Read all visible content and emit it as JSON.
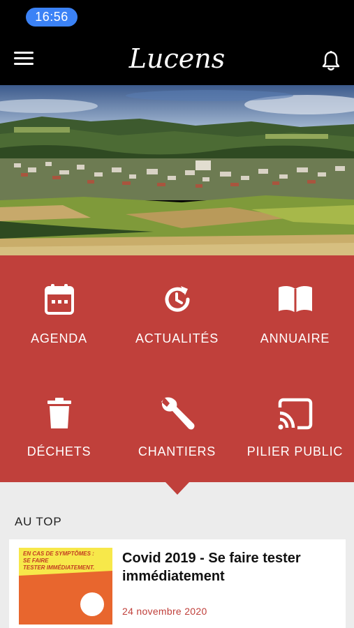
{
  "status_bar": {
    "time": "16:56"
  },
  "nav": {
    "logo_text": "Lucens",
    "menu_icon": "hamburger-menu-icon",
    "bell_icon": "bell-icon"
  },
  "hero": {
    "description": "Panoramic landscape of village in valley"
  },
  "tiles": [
    {
      "label": "AGENDA",
      "icon": "calendar-icon"
    },
    {
      "label": "ACTUALITÉS",
      "icon": "refresh-clock-icon"
    },
    {
      "label": "ANNUAIRE",
      "icon": "open-book-icon"
    },
    {
      "label": "DÉCHETS",
      "icon": "trash-icon"
    },
    {
      "label": "CHANTIERS",
      "icon": "wrench-icon"
    },
    {
      "label": "PILIER PUBLIC",
      "icon": "cast-icon"
    }
  ],
  "section": {
    "title": "AU TOP"
  },
  "article": {
    "title": "Covid 2019 - Se faire tester immédiatement",
    "date": "24 novembre 2020",
    "thumb_lines": [
      "EN CAS DE SYMPTÔMES :",
      "SE FAIRE",
      "TESTER IMMÉDIATEMENT."
    ]
  },
  "colors": {
    "accent": "#c0403b",
    "status_pill": "#3b82f6",
    "background": "#000000",
    "lower_bg": "#ececec"
  }
}
